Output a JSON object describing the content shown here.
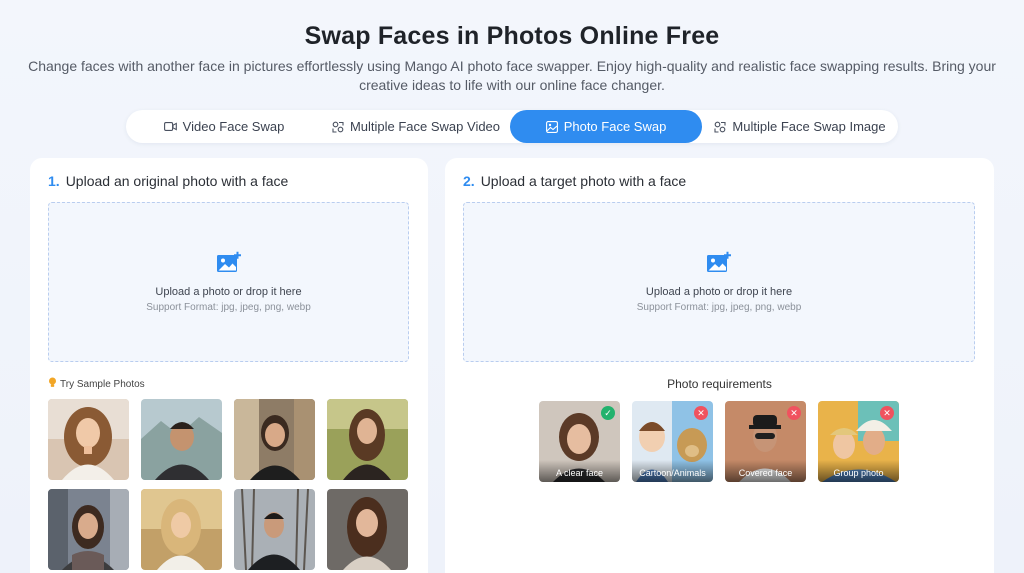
{
  "header": {
    "title": "Swap Faces in Photos Online Free",
    "subtitle": "Change faces with another face in pictures effortlessly using Mango AI photo face swapper. Enjoy high-quality and realistic face swapping results. Bring your creative ideas to life with our online face changer."
  },
  "tabs": [
    {
      "label": "Video Face Swap",
      "icon": "video-icon",
      "active": false
    },
    {
      "label": "Multiple Face Swap Video",
      "icon": "multi-face-icon",
      "active": false
    },
    {
      "label": "Photo Face Swap",
      "icon": "image-icon",
      "active": true
    },
    {
      "label": "Multiple Face Swap Image",
      "icon": "multi-face-icon",
      "active": false
    }
  ],
  "left_panel": {
    "step": "1.",
    "heading": "Upload an original photo with a face",
    "upload_text": "Upload a photo or drop it here",
    "support_text": "Support Format: jpg, jpeg, png, webp",
    "sample_label": "Try Sample Photos",
    "samples_count_visible": 8
  },
  "right_panel": {
    "step": "2.",
    "heading": "Upload a target photo with a face",
    "upload_text": "Upload a photo or drop it here",
    "support_text": "Support Format: jpg, jpeg, png, webp",
    "requirements_title": "Photo requirements",
    "requirements": [
      {
        "label": "A clear face",
        "status": "ok"
      },
      {
        "label": "Cartoon/Animals",
        "status": "no"
      },
      {
        "label": "Covered face",
        "status": "no"
      },
      {
        "label": "Group photo",
        "status": "no"
      }
    ]
  },
  "colors": {
    "accent": "#2f8cf0",
    "ok": "#23b26d",
    "no": "#f0525f"
  }
}
